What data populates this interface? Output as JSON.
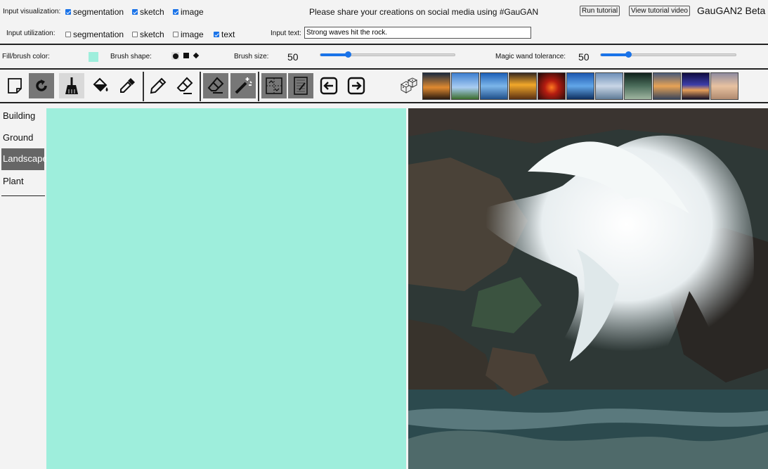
{
  "header": {
    "input_visualization_label": "Input visualization:",
    "input_utilization_label": "Input utilization:",
    "visualization_options": [
      {
        "label": "segmentation",
        "checked": true
      },
      {
        "label": "sketch",
        "checked": true
      },
      {
        "label": "image",
        "checked": true
      }
    ],
    "utilization_options": [
      {
        "label": "segmentation",
        "checked": false
      },
      {
        "label": "sketch",
        "checked": false
      },
      {
        "label": "image",
        "checked": false
      },
      {
        "label": "text",
        "checked": true
      }
    ],
    "share_message": "Please share your creations on social media using #GauGAN",
    "input_text_label": "Input text:",
    "input_text_value": "Strong waves hit the rock.",
    "run_tutorial_label": "Run tutorial",
    "view_video_label": "View tutorial video",
    "app_title": "GauGAN2 Beta"
  },
  "controls": {
    "fill_color_label": "Fill/brush color:",
    "fill_color": "#9eeedc",
    "brush_shape_label": "Brush shape:",
    "brush_size_label": "Brush size:",
    "brush_size_value": "50",
    "brush_size_fraction": 0.2,
    "wand_tolerance_label": "Magic wand tolerance:",
    "wand_tolerance_value": "50",
    "wand_tolerance_fraction": 0.2
  },
  "toolbar": {
    "tools": [
      "new-page-icon",
      "undo-icon",
      "brush-icon",
      "fill-bucket-icon",
      "eyedropper-icon",
      "pencil-icon",
      "sketch-eraser-icon",
      "eraser-icon",
      "magic-wand-icon",
      "segmentation-layer-icon",
      "sketch-layer-icon",
      "arrow-left-icon",
      "arrow-right-icon",
      "random-dice-icon"
    ]
  },
  "style_thumbnails": [
    "sunset-lake",
    "blue-sky-road",
    "blue-sky-sea",
    "orange-sunset-sea",
    "red-sunset-sky",
    "blue-lake-trees",
    "cloudy-sea",
    "green-night-lake",
    "golden-clouds",
    "purple-dusk",
    "pastel-sunset"
  ],
  "categories": [
    {
      "label": "Building",
      "selected": false
    },
    {
      "label": "Ground",
      "selected": false
    },
    {
      "label": "Landscape",
      "selected": true
    },
    {
      "label": "Plant",
      "selected": false
    }
  ],
  "canvas": {
    "segmentation_color": "#9eeedc",
    "output_image": "waves-hitting-rocks"
  }
}
